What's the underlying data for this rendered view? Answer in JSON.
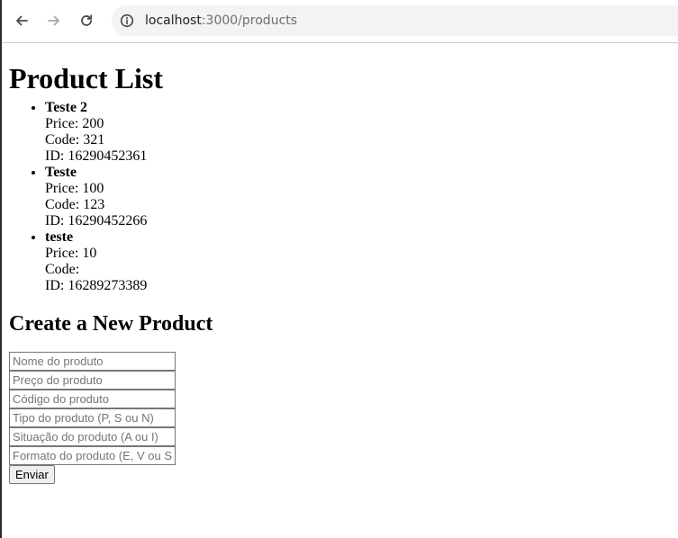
{
  "browser": {
    "url_host": "localhost",
    "url_path": ":3000/products",
    "icons": [
      "back-arrow-icon",
      "forward-arrow-icon",
      "reload-icon",
      "site-info-icon"
    ]
  },
  "page": {
    "title": "Product List",
    "products": [
      {
        "name": "Teste 2",
        "price_label": "Price:",
        "price": "200",
        "code_label": "Code:",
        "code": "321",
        "id_label": "ID:",
        "id": "16290452361"
      },
      {
        "name": "Teste",
        "price_label": "Price:",
        "price": "100",
        "code_label": "Code:",
        "code": "123",
        "id_label": "ID:",
        "id": "16290452266"
      },
      {
        "name": "teste",
        "price_label": "Price:",
        "price": "10",
        "code_label": "Code:",
        "code": "",
        "id_label": "ID:",
        "id": "16289273389"
      }
    ],
    "form": {
      "heading": "Create a New Product",
      "fields": [
        {
          "placeholder": "Nome do produto",
          "value": ""
        },
        {
          "placeholder": "Preço do produto",
          "value": ""
        },
        {
          "placeholder": "Código do produto",
          "value": ""
        },
        {
          "placeholder": "Tipo do produto (P, S ou N)",
          "value": ""
        },
        {
          "placeholder": "Situação do produto (A ou I)",
          "value": ""
        },
        {
          "placeholder": "Formato do produto (E, V ou S)",
          "value": ""
        }
      ],
      "submit_label": "Enviar"
    }
  }
}
